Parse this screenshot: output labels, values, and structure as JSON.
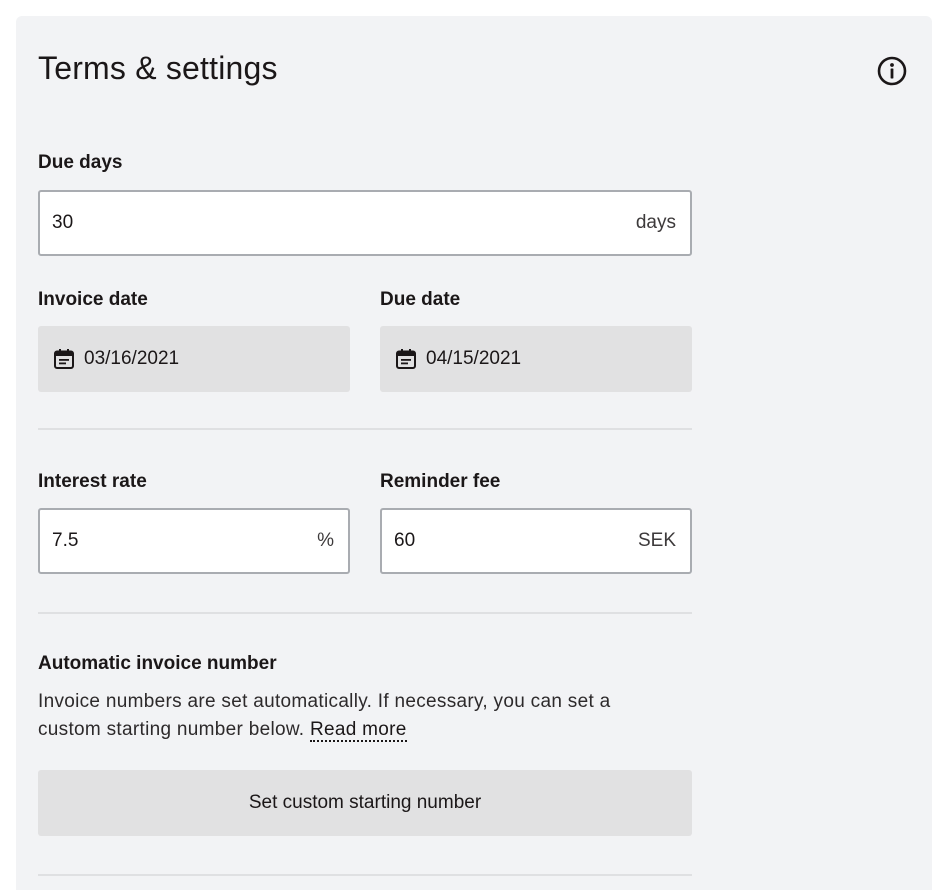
{
  "panel": {
    "title": "Terms & settings",
    "info_icon": "info-circle-icon"
  },
  "due_days": {
    "label": "Due days",
    "value": "30",
    "suffix": "days"
  },
  "invoice_date": {
    "label": "Invoice date",
    "value": "03/16/2021",
    "icon": "calendar-icon"
  },
  "due_date": {
    "label": "Due date",
    "value": "04/15/2021",
    "icon": "calendar-icon"
  },
  "interest_rate": {
    "label": "Interest rate",
    "value": "7.5",
    "suffix": "%"
  },
  "reminder_fee": {
    "label": "Reminder fee",
    "value": "60",
    "suffix": "SEK"
  },
  "invoice_number": {
    "heading": "Automatic invoice number",
    "description": "Invoice numbers are set automatically. If necessary, you can set a custom starting number below.",
    "read_more_label": "Read more",
    "button_label": "Set custom starting number"
  },
  "colors": {
    "panel_background": "#f2f3f5",
    "field_border": "#a9acb1",
    "disabled_field": "#e1e1e2",
    "text": "#1b1718"
  }
}
